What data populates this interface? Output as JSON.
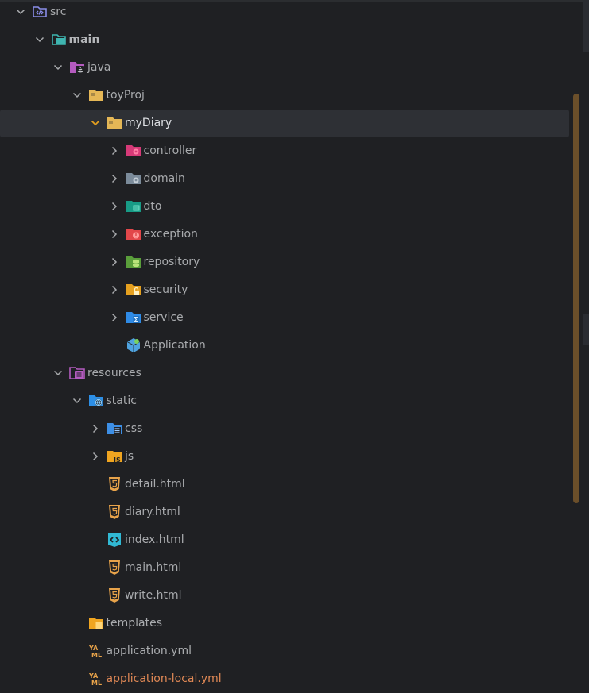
{
  "tree": {
    "rows": [
      {
        "label": "src",
        "level": 0,
        "expanded": true,
        "icon": "source-root-icon"
      },
      {
        "label": "main",
        "level": 1,
        "expanded": true,
        "icon": "module-icon"
      },
      {
        "label": "java",
        "level": 2,
        "expanded": true,
        "icon": "java-sources-folder-icon"
      },
      {
        "label": "toyProj",
        "level": 3,
        "expanded": true,
        "icon": "package-folder-icon"
      },
      {
        "label": "myDiary",
        "level": 4,
        "expanded": true,
        "icon": "package-folder-icon",
        "selected": true
      },
      {
        "label": "controller",
        "level": 5,
        "expanded": false,
        "icon": "controller-folder-icon"
      },
      {
        "label": "domain",
        "level": 5,
        "expanded": false,
        "icon": "domain-folder-icon"
      },
      {
        "label": "dto",
        "level": 5,
        "expanded": false,
        "icon": "dto-folder-icon"
      },
      {
        "label": "exception",
        "level": 5,
        "expanded": false,
        "icon": "exception-folder-icon"
      },
      {
        "label": "repository",
        "level": 5,
        "expanded": false,
        "icon": "repository-folder-icon"
      },
      {
        "label": "security",
        "level": 5,
        "expanded": false,
        "icon": "security-folder-icon"
      },
      {
        "label": "service",
        "level": 5,
        "expanded": false,
        "icon": "service-folder-icon"
      },
      {
        "label": "Application",
        "level": 5,
        "expanded": null,
        "icon": "spring-application-icon"
      },
      {
        "label": "resources",
        "level": 2,
        "expanded": true,
        "icon": "resources-folder-icon"
      },
      {
        "label": "static",
        "level": 3,
        "expanded": true,
        "icon": "static-web-folder-icon"
      },
      {
        "label": "css",
        "level": 4,
        "expanded": false,
        "icon": "css-folder-icon"
      },
      {
        "label": "js",
        "level": 4,
        "expanded": false,
        "icon": "js-folder-icon"
      },
      {
        "label": "detail.html",
        "level": 4,
        "expanded": null,
        "icon": "html5-file-icon"
      },
      {
        "label": "diary.html",
        "level": 4,
        "expanded": null,
        "icon": "html5-file-icon"
      },
      {
        "label": "index.html",
        "level": 4,
        "expanded": null,
        "icon": "html-code-file-icon"
      },
      {
        "label": "main.html",
        "level": 4,
        "expanded": null,
        "icon": "html5-file-icon"
      },
      {
        "label": "write.html",
        "level": 4,
        "expanded": null,
        "icon": "html5-file-icon"
      },
      {
        "label": "templates",
        "level": 3,
        "expanded": null,
        "icon": "templates-folder-icon"
      },
      {
        "label": "application.yml",
        "level": 3,
        "expanded": null,
        "icon": "yaml-file-icon"
      },
      {
        "label": "application-local.yml",
        "level": 3,
        "expanded": null,
        "icon": "yaml-file-icon",
        "highlight": "orange"
      }
    ]
  },
  "colors": {
    "background": "#1f2023",
    "selection": "#2e3035",
    "text": "#a9abae",
    "highlight_text": "#e08855",
    "scrollbar_thumb": "#6b4f2a"
  }
}
